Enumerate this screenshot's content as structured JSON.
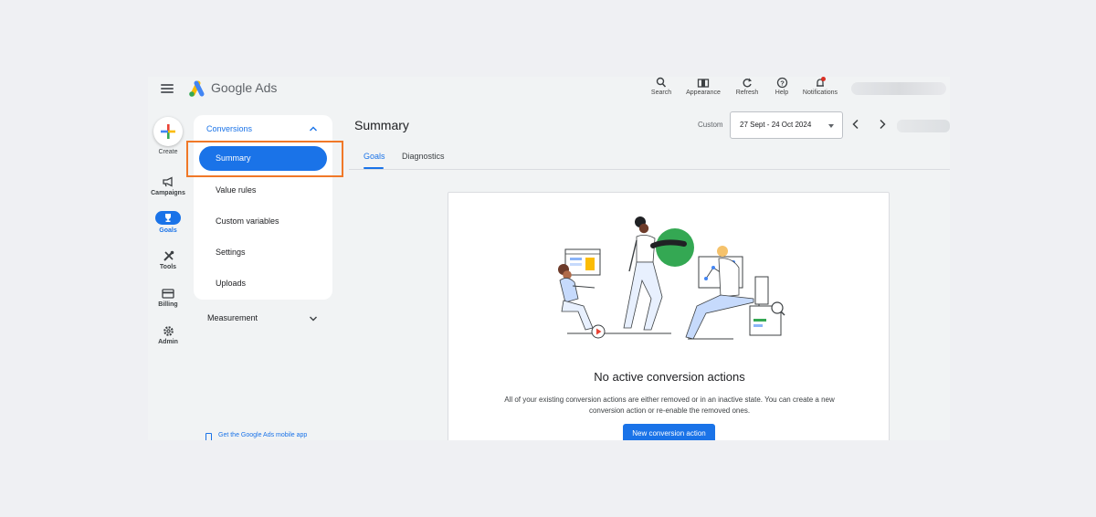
{
  "header": {
    "app_name": "Google Ads",
    "actions": [
      {
        "label": "Search",
        "icon": "search-icon"
      },
      {
        "label": "Appearance",
        "icon": "appearance-icon"
      },
      {
        "label": "Refresh",
        "icon": "refresh-icon"
      },
      {
        "label": "Help",
        "icon": "help-icon"
      },
      {
        "label": "Notifications",
        "icon": "bell-icon"
      }
    ]
  },
  "rail": {
    "create_label": "Create",
    "items": [
      {
        "label": "Campaigns",
        "icon": "megaphone-icon"
      },
      {
        "label": "Goals",
        "icon": "trophy-icon",
        "active": true
      },
      {
        "label": "Tools",
        "icon": "tools-icon"
      },
      {
        "label": "Billing",
        "icon": "credit-card-icon"
      },
      {
        "label": "Admin",
        "icon": "gear-icon"
      }
    ]
  },
  "nav": {
    "section": "Conversions",
    "items": [
      {
        "label": "Summary",
        "selected": true
      },
      {
        "label": "Value rules"
      },
      {
        "label": "Custom variables"
      },
      {
        "label": "Settings"
      },
      {
        "label": "Uploads"
      }
    ],
    "measurement": "Measurement",
    "mobile_link": "Get the Google Ads mobile app"
  },
  "main": {
    "title": "Summary",
    "date_label": "Custom",
    "date_range": "27 Sept - 24 Oct 2024",
    "tabs": [
      {
        "label": "Goals",
        "active": true
      },
      {
        "label": "Diagnostics"
      }
    ],
    "empty_state": {
      "title": "No active conversion actions",
      "description": "All of your existing conversion actions are either removed or in an inactive state. You can create a new conversion action or re-enable the removed ones.",
      "button": "New conversion action"
    }
  },
  "colors": {
    "accent": "#1a73e8",
    "highlight": "#f07828",
    "notification_badge": "#d93025"
  }
}
